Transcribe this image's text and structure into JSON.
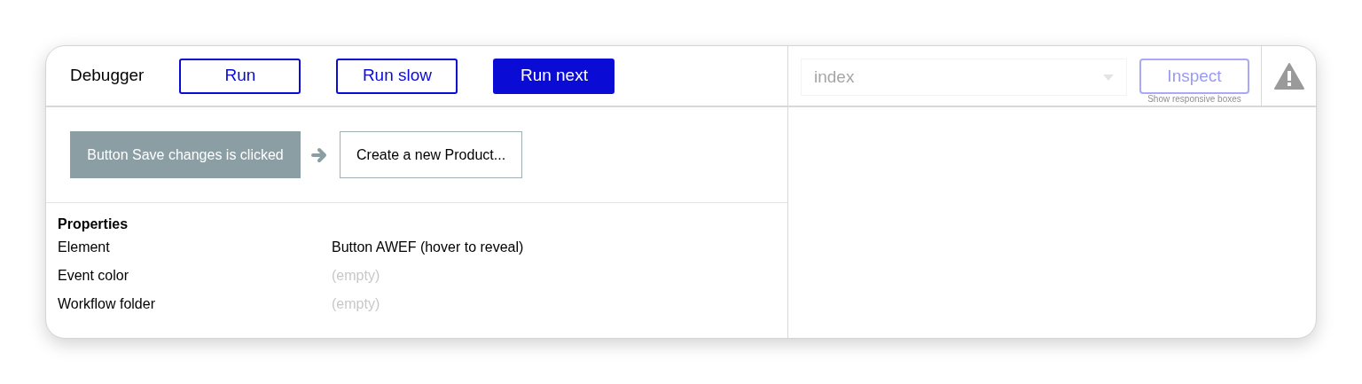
{
  "toolbar": {
    "title": "Debugger",
    "buttons": [
      {
        "label": "Run",
        "kind": "outline"
      },
      {
        "label": "Run slow",
        "kind": "outline"
      },
      {
        "label": "Run next",
        "kind": "filled"
      }
    ]
  },
  "inspector": {
    "select": {
      "value": "index",
      "disabled": true
    },
    "inspect_button": {
      "label": "Inspect",
      "disabled": true
    },
    "hint": "Show responsive boxes"
  },
  "steps": [
    {
      "label": "Button Save changes is clicked",
      "selected": true
    },
    {
      "label": "Create a new Product...",
      "selected": false
    }
  ],
  "properties": {
    "title": "Properties",
    "rows": [
      {
        "name": "Element",
        "value": "Button AWEF (hover to reveal)",
        "empty": false
      },
      {
        "name": "Event color",
        "value": "(empty)",
        "empty": true
      },
      {
        "name": "Workflow folder",
        "value": "(empty)",
        "empty": true
      }
    ]
  }
}
